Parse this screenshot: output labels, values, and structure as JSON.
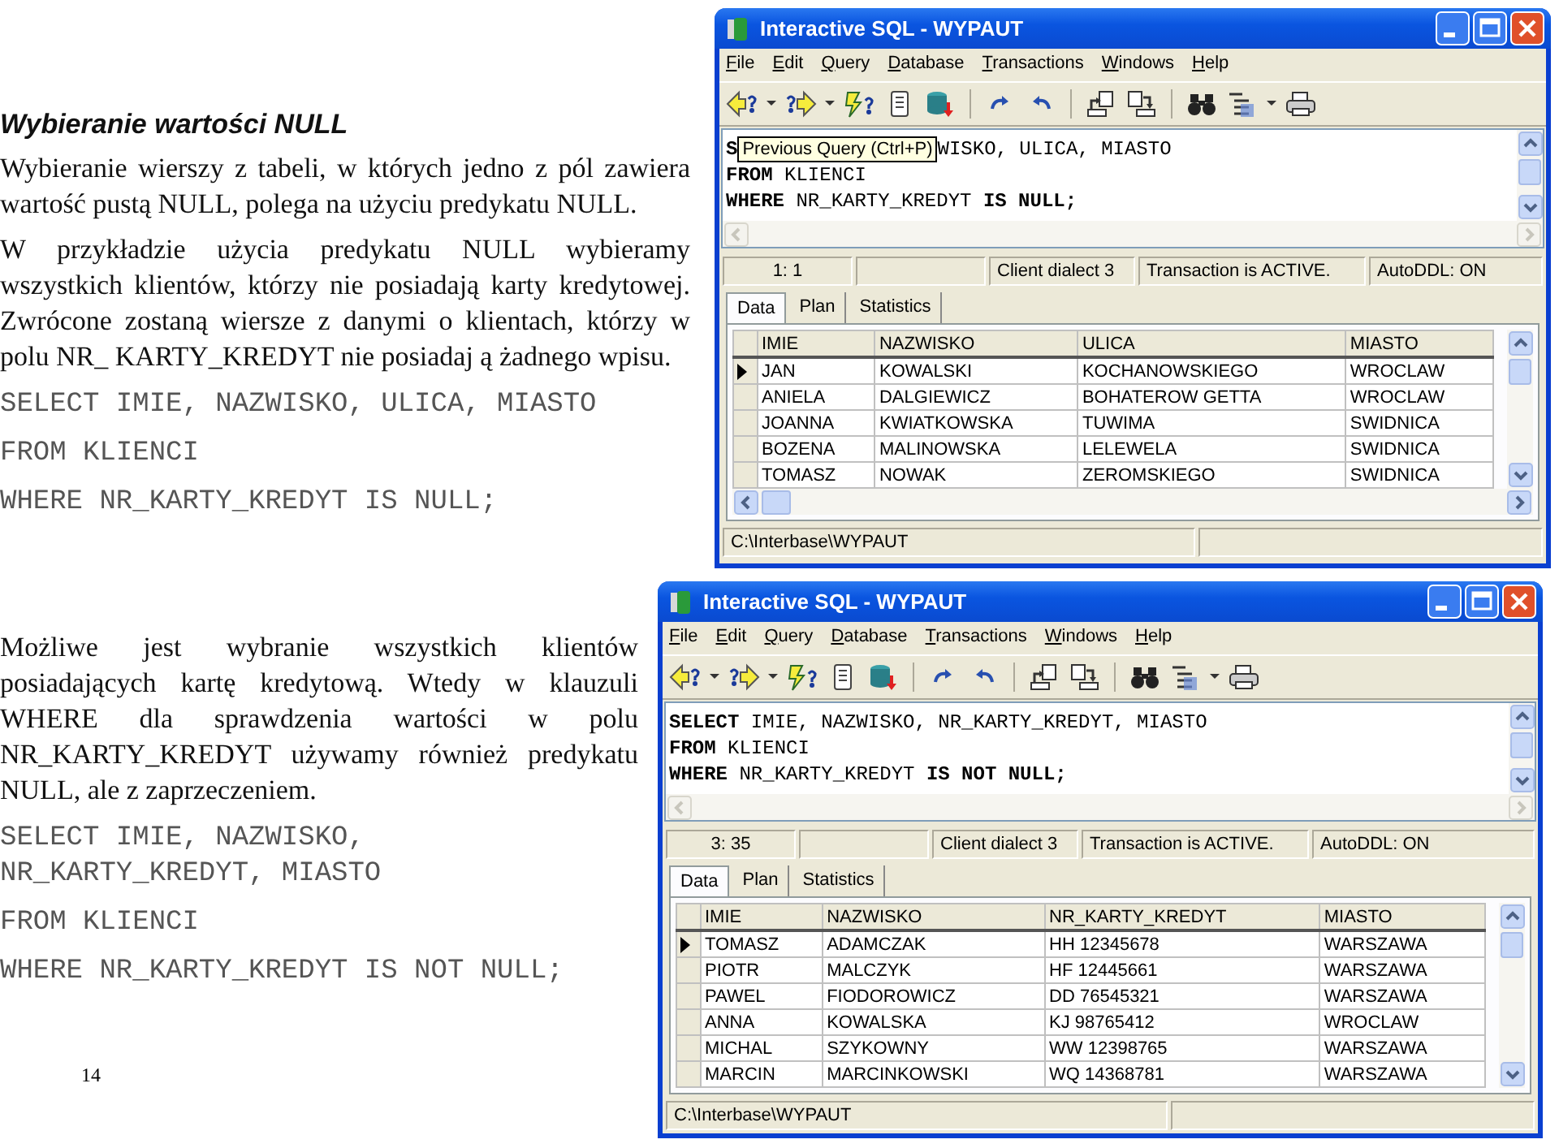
{
  "sections": [
    {
      "heading": "Wybieranie wartości NULL",
      "paragraphs": [
        "Wybieranie wierszy z tabeli, w których jedno z pól zawiera wartość pustą NULL, polega na użyciu predykatu NULL.",
        "W przykładzie użycia predykatu NULL wybieramy wszystkich klientów, którzy nie posiadają karty kredytowej. Zwrócone zostaną wiersze z danymi o klientach, którzy w polu NR_ KARTY_KREDYT nie posiadaj ą żadnego wpisu."
      ],
      "code": [
        "SELECT IMIE, NAZWISKO, ULICA, MIASTO",
        "FROM KLIENCI",
        "WHERE NR_KARTY_KREDYT IS NULL;"
      ],
      "window": {
        "title": "Interactive SQL - WYPAUT",
        "menu": [
          "File",
          "Edit",
          "Query",
          "Database",
          "Transactions",
          "Windows",
          "Help"
        ],
        "editor": [
          [
            {
              "kind": "code",
              "text": "**S**"
            },
            {
              "kind": "tooltip",
              "text": "Previous Query (Ctrl+P)"
            },
            {
              "kind": "code",
              "text": "WISKO, ULICA, MIASTO"
            }
          ],
          [
            {
              "kind": "code",
              "text": "**FROM** KLIENCI"
            }
          ],
          [
            {
              "kind": "code",
              "text": "**WHERE** NR_KARTY_KREDYT **IS NULL;**"
            }
          ]
        ],
        "status": [
          "1: 1",
          "Client dialect 3",
          "Transaction is ACTIVE.",
          "AutoDDL: ON"
        ],
        "tabs": [
          {
            "label": "Data",
            "selected": true
          },
          {
            "label": "Plan",
            "selected": false
          },
          {
            "label": "Statistics",
            "selected": false
          }
        ],
        "grid": {
          "horizontal_scrollbar": true,
          "columns": [
            "IMIE",
            "NAZWISKO",
            "ULICA",
            "MIASTO"
          ],
          "rows": [
            {
              "current": true,
              "cells": [
                "JAN",
                "KOWALSKI",
                "KOCHANOWSKIEGO",
                "WROCLAW"
              ]
            },
            {
              "current": false,
              "cells": [
                "ANIELA",
                "DALGIEWICZ",
                "BOHATEROW GETTA",
                "WROCLAW"
              ]
            },
            {
              "current": false,
              "cells": [
                "JOANNA",
                "KWIATKOWSKA",
                "TUWIMA",
                "SWIDNICA"
              ]
            },
            {
              "current": false,
              "cells": [
                "BOZENA",
                "MALINOWSKA",
                "LELEWELA",
                "SWIDNICA"
              ]
            },
            {
              "current": false,
              "cells": [
                "TOMASZ",
                "NOWAK",
                "ZEROMSKIEGO",
                "SWIDNICA"
              ]
            }
          ]
        },
        "path": "C:\\Interbase\\WYPAUT"
      }
    },
    {
      "paragraphs": [
        "Możliwe jest wybranie wszystkich klientów posiadających kartę kredytową. Wtedy w klauzuli WHERE dla sprawdzenia wartości w polu NR_KARTY_KREDYT używamy również predykatu NULL, ale z zaprzeczeniem."
      ],
      "code": [
        "SELECT IMIE, NAZWISKO, NR_KARTY_KREDYT, MIASTO",
        "FROM KLIENCI",
        "WHERE NR_KARTY_KREDYT IS NOT NULL;"
      ],
      "window": {
        "title": "Interactive SQL - WYPAUT",
        "menu": [
          "File",
          "Edit",
          "Query",
          "Database",
          "Transactions",
          "Windows",
          "Help"
        ],
        "editor": [
          [
            {
              "kind": "code",
              "text": "**SELECT** IMIE, NAZWISKO, NR_KARTY_KREDYT, MIASTO"
            }
          ],
          [
            {
              "kind": "code",
              "text": "**FROM** KLIENCI"
            }
          ],
          [
            {
              "kind": "code",
              "text": "**WHERE** NR_KARTY_KREDYT **IS NOT NULL;**"
            }
          ]
        ],
        "status": [
          "3: 35",
          "Client dialect 3",
          "Transaction is ACTIVE.",
          "AutoDDL: ON"
        ],
        "tabs": [
          {
            "label": "Data",
            "selected": true
          },
          {
            "label": "Plan",
            "selected": false
          },
          {
            "label": "Statistics",
            "selected": false
          }
        ],
        "grid": {
          "horizontal_scrollbar": false,
          "columns": [
            "IMIE",
            "NAZWISKO",
            "NR_KARTY_KREDYT",
            "MIASTO"
          ],
          "rows": [
            {
              "current": true,
              "cells": [
                "TOMASZ",
                "ADAMCZAK",
                "HH 12345678",
                "WARSZAWA"
              ]
            },
            {
              "current": false,
              "cells": [
                "PIOTR",
                "MALCZYK",
                "HF 12445661",
                "WARSZAWA"
              ]
            },
            {
              "current": false,
              "cells": [
                "PAWEL",
                "FIODOROWICZ",
                "DD 76545321",
                "WARSZAWA"
              ]
            },
            {
              "current": false,
              "cells": [
                "ANNA",
                "KOWALSKA",
                "KJ 98765412",
                "WROCLAW"
              ]
            },
            {
              "current": false,
              "cells": [
                "MICHAL",
                "SZYKOWNY",
                "WW 12398765",
                "WARSZAWA"
              ]
            },
            {
              "current": false,
              "cells": [
                "MARCIN",
                "MARCINKOWSKI",
                "WQ 14368781",
                "WARSZAWA"
              ]
            }
          ]
        },
        "path": "C:\\Interbase\\WYPAUT"
      }
    }
  ],
  "page_number": "14"
}
